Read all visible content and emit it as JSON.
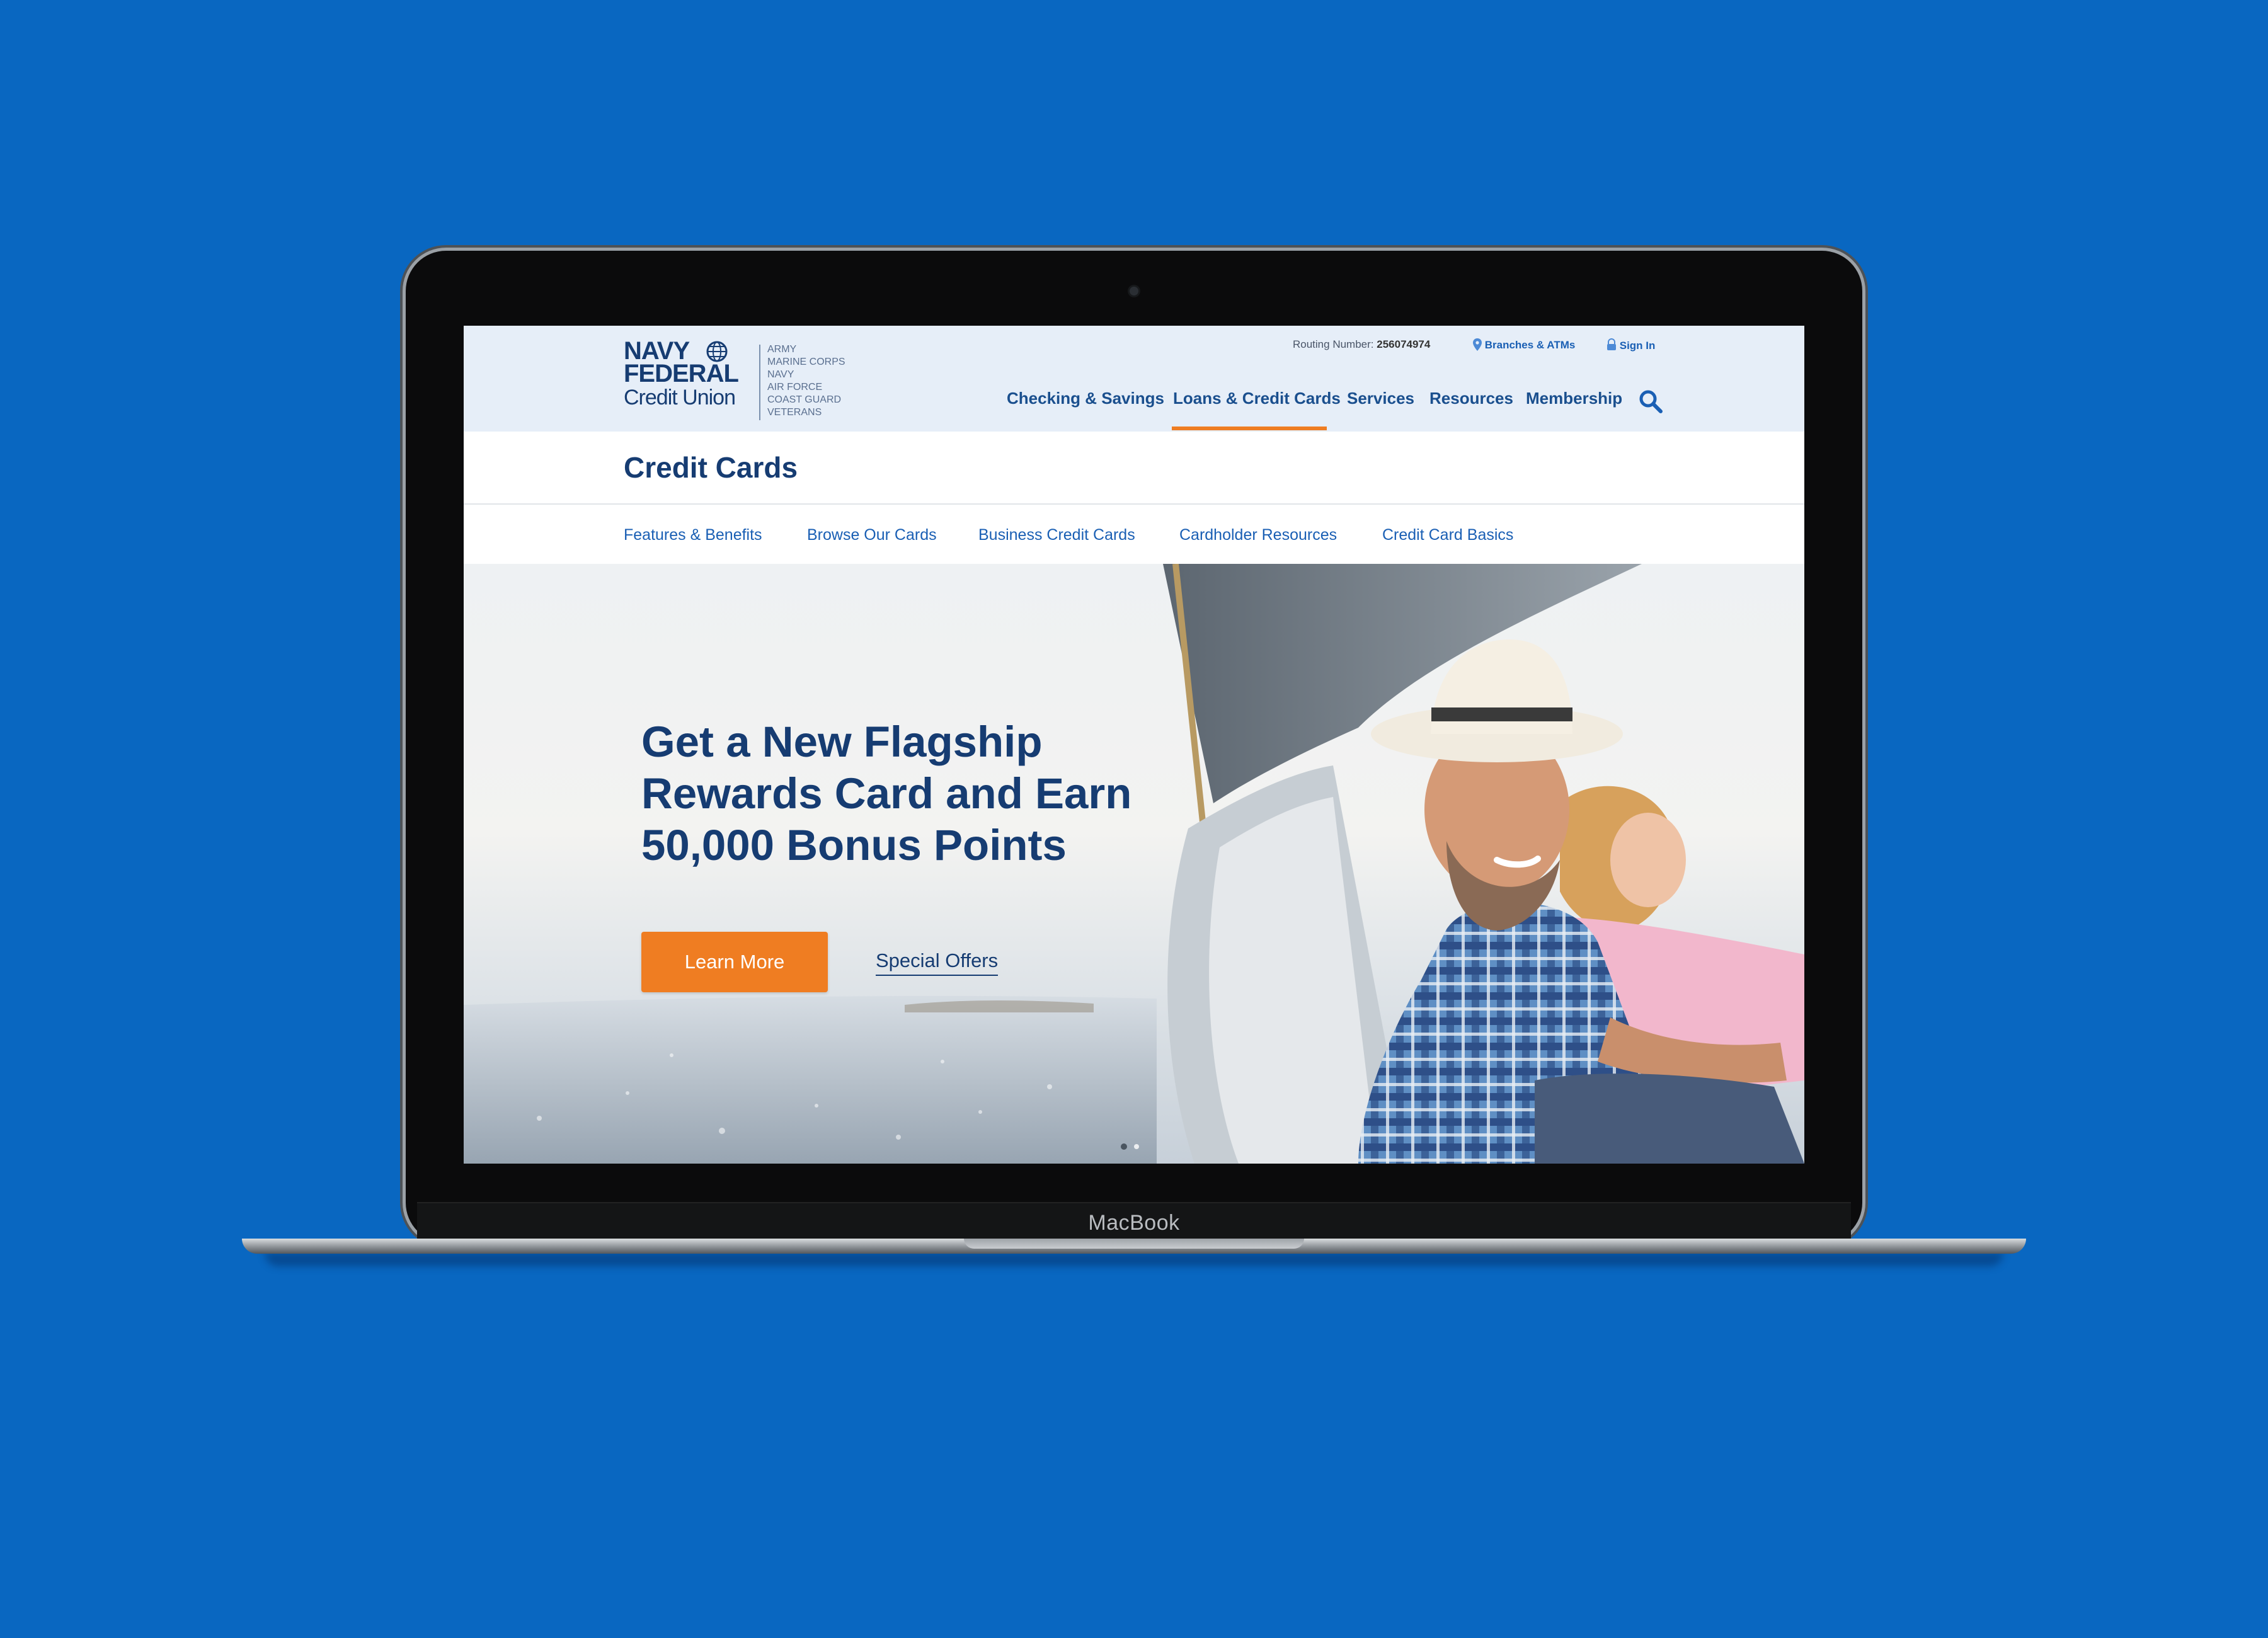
{
  "device": {
    "label": "MacBook"
  },
  "header": {
    "logo": {
      "line1": "NAVY",
      "line2": "FEDERAL",
      "line3": "Credit Union"
    },
    "branches": [
      "ARMY",
      "MARINE CORPS",
      "NAVY",
      "AIR FORCE",
      "COAST GUARD",
      "VETERANS"
    ],
    "routing_label": "Routing Number:",
    "routing_number": "256074974",
    "branches_atms": "Branches & ATMs",
    "sign_in": "Sign In",
    "nav": [
      "Checking & Savings",
      "Loans & Credit Cards",
      "Services",
      "Resources",
      "Membership"
    ],
    "active_nav": "Loans & Credit Cards"
  },
  "section": {
    "title": "Credit Cards",
    "subnav": [
      "Features & Benefits",
      "Browse Our Cards",
      "Business Credit Cards",
      "Cardholder Resources",
      "Credit Card Basics"
    ]
  },
  "hero": {
    "title_lines": [
      "Get a New Flagship",
      "Rewards Card and Earn",
      "50,000 Bonus Points"
    ],
    "cta": "Learn More",
    "link": "Special Offers"
  },
  "colors": {
    "background": "#0967c1",
    "brand_navy": "#163c72",
    "accent_orange": "#ef7d22",
    "link_blue": "#1a5fb4"
  },
  "icons": [
    "globe-icon",
    "location-pin-icon",
    "lock-icon",
    "search-icon"
  ]
}
